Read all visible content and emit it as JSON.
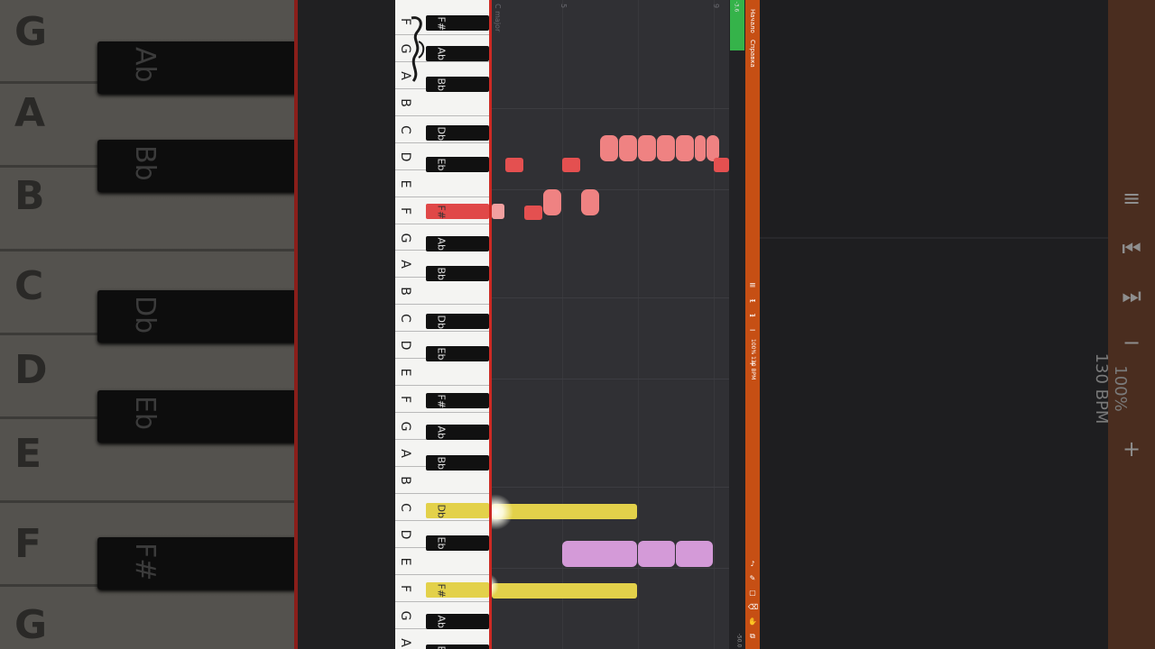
{
  "background_mirror": {
    "white_keys": [
      "G",
      "A",
      "B",
      "C",
      "D",
      "E",
      "F",
      "G"
    ],
    "black_keys": [
      "Ab",
      "Bb",
      "Db",
      "Eb",
      "F#"
    ],
    "controls": {
      "menu": "≡",
      "skip_start": "⏮",
      "skip_end": "⏭",
      "zoom_out": "−",
      "zoom_in": "+",
      "zoom_level": "100%",
      "tempo": "130 BPM"
    }
  },
  "piano": {
    "white_keys": [
      "F",
      "G",
      "A",
      "B",
      "C",
      "D",
      "E",
      "F",
      "G",
      "A",
      "B",
      "C",
      "D",
      "E",
      "F",
      "G",
      "A",
      "B",
      "C",
      "D",
      "E",
      "F",
      "G",
      "A"
    ],
    "black_keys": [
      {
        "label": "F#",
        "state": "normal"
      },
      {
        "label": "Ab",
        "state": "normal"
      },
      {
        "label": "Bb",
        "state": "normal"
      },
      {
        "label": "Db",
        "state": "normal"
      },
      {
        "label": "Eb",
        "state": "normal"
      },
      {
        "label": "F#",
        "state": "pressed-red"
      },
      {
        "label": "Ab",
        "state": "normal"
      },
      {
        "label": "Bb",
        "state": "normal"
      },
      {
        "label": "Db",
        "state": "normal"
      },
      {
        "label": "Eb",
        "state": "normal"
      },
      {
        "label": "F#",
        "state": "normal"
      },
      {
        "label": "Ab",
        "state": "normal"
      },
      {
        "label": "Bb",
        "state": "normal"
      },
      {
        "label": "Db",
        "state": "pressed-yellow"
      },
      {
        "label": "Eb",
        "state": "normal"
      },
      {
        "label": "F#",
        "state": "pressed-yellow"
      },
      {
        "label": "Ab",
        "state": "normal"
      },
      {
        "label": "Bb",
        "state": "normal"
      }
    ]
  },
  "grid": {
    "bar_markers": [
      "C major",
      "5",
      "9"
    ]
  },
  "meter": {
    "top_value": "-3.6",
    "bottom_value": "-50.0"
  },
  "toolbar": {
    "menu_label": "Начало",
    "help_label": "Справка",
    "zoom_level": "100%",
    "tempo": "130 BPM",
    "buttons": {
      "menu": "≡",
      "skip_start": "⏮",
      "skip_end": "⏭",
      "zoom_out": "−",
      "zoom_in": "+"
    },
    "tools": {
      "metronome": "♪",
      "pencil": "✎",
      "select": "▢",
      "eraser": "⌫",
      "hand": "✋",
      "copy": "⧉"
    }
  },
  "colors": {
    "melody_notes": "#ef8282",
    "active_melody": "#e45050",
    "chord_notes": "#e3d14a",
    "bass_notes": "#d49ad8",
    "playhead": "#cc2a24",
    "toolbar": "#c64f14",
    "meter": "#35b34a"
  }
}
